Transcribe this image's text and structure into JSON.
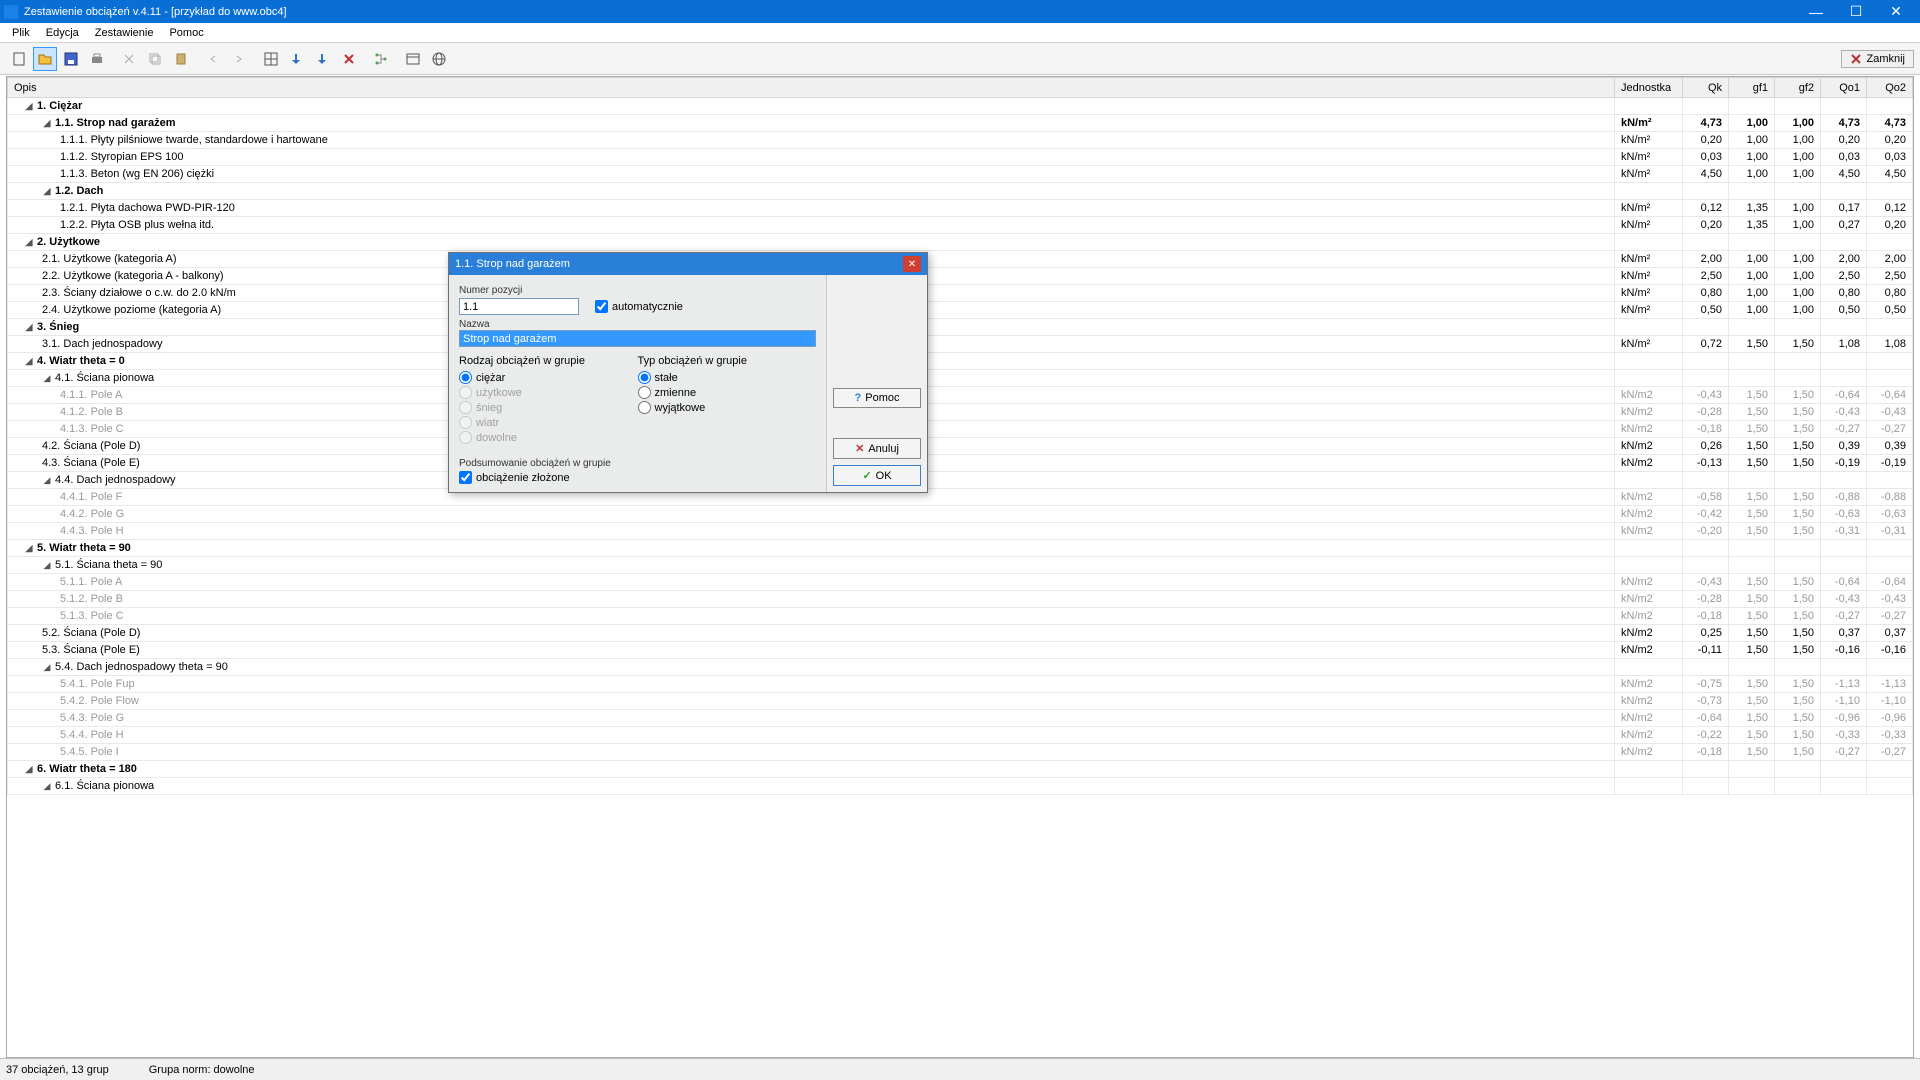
{
  "titlebar": {
    "title": "Zestawienie obciążeń v.4.11 - [przykład do www.obc4]"
  },
  "menu": {
    "plik": "Plik",
    "edycja": "Edycja",
    "zest": "Zestawienie",
    "pomoc": "Pomoc"
  },
  "toolbar": {
    "close": "Zamknij"
  },
  "headers": {
    "opis": "Opis",
    "jedn": "Jednostka",
    "qk": "Qk",
    "gf1": "gf1",
    "gf2": "gf2",
    "qo1": "Qo1",
    "qo2": "Qo2"
  },
  "rows": [
    {
      "lvl": 0,
      "arrow": 1,
      "bold": 1,
      "dim": 0,
      "opis": "1.  Ciężar",
      "j": "",
      "qk": "",
      "g1": "",
      "g2": "",
      "q1": "",
      "q2": ""
    },
    {
      "lvl": 1,
      "arrow": 1,
      "bold": 1,
      "dim": 0,
      "opis": "1.1.  Strop nad garażem",
      "j": "kN/m²",
      "qk": "4,73",
      "g1": "1,00",
      "g2": "1,00",
      "q1": "4,73",
      "q2": "4,73"
    },
    {
      "lvl": 2,
      "arrow": 0,
      "bold": 0,
      "dim": 0,
      "opis": "1.1.1.  Płyty pilśniowe twarde, standardowe i hartowane",
      "j": "kN/m²",
      "qk": "0,20",
      "g1": "1,00",
      "g2": "1,00",
      "q1": "0,20",
      "q2": "0,20"
    },
    {
      "lvl": 2,
      "arrow": 0,
      "bold": 0,
      "dim": 0,
      "opis": "1.1.2.  Styropian EPS 100",
      "j": "kN/m²",
      "qk": "0,03",
      "g1": "1,00",
      "g2": "1,00",
      "q1": "0,03",
      "q2": "0,03"
    },
    {
      "lvl": 2,
      "arrow": 0,
      "bold": 0,
      "dim": 0,
      "opis": "1.1.3.  Beton (wg EN 206) ciężki",
      "j": "kN/m²",
      "qk": "4,50",
      "g1": "1,00",
      "g2": "1,00",
      "q1": "4,50",
      "q2": "4,50"
    },
    {
      "lvl": 1,
      "arrow": 1,
      "bold": 1,
      "dim": 0,
      "opis": "1.2.  Dach",
      "j": "",
      "qk": "",
      "g1": "",
      "g2": "",
      "q1": "",
      "q2": ""
    },
    {
      "lvl": 2,
      "arrow": 0,
      "bold": 0,
      "dim": 0,
      "opis": "1.2.1.  Płyta dachowa PWD-PIR-120",
      "j": "kN/m²",
      "qk": "0,12",
      "g1": "1,35",
      "g2": "1,00",
      "q1": "0,17",
      "q2": "0,12"
    },
    {
      "lvl": 2,
      "arrow": 0,
      "bold": 0,
      "dim": 0,
      "opis": "1.2.2.  Płyta OSB plus wełna itd.",
      "j": "kN/m²",
      "qk": "0,20",
      "g1": "1,35",
      "g2": "1,00",
      "q1": "0,27",
      "q2": "0,20"
    },
    {
      "lvl": 0,
      "arrow": 1,
      "bold": 1,
      "dim": 0,
      "opis": "2.  Użytkowe",
      "j": "",
      "qk": "",
      "g1": "",
      "g2": "",
      "q1": "",
      "q2": ""
    },
    {
      "lvl": 1,
      "arrow": 0,
      "bold": 0,
      "dim": 0,
      "opis": "2.1.  Użytkowe (kategoria A)",
      "j": "kN/m²",
      "qk": "2,00",
      "g1": "1,00",
      "g2": "1,00",
      "q1": "2,00",
      "q2": "2,00"
    },
    {
      "lvl": 1,
      "arrow": 0,
      "bold": 0,
      "dim": 0,
      "opis": "2.2.  Użytkowe (kategoria A - balkony)",
      "j": "kN/m²",
      "qk": "2,50",
      "g1": "1,00",
      "g2": "1,00",
      "q1": "2,50",
      "q2": "2,50"
    },
    {
      "lvl": 1,
      "arrow": 0,
      "bold": 0,
      "dim": 0,
      "opis": "2.3.  Ściany działowe o c.w. do 2.0 kN/m",
      "j": "kN/m²",
      "qk": "0,80",
      "g1": "1,00",
      "g2": "1,00",
      "q1": "0,80",
      "q2": "0,80"
    },
    {
      "lvl": 1,
      "arrow": 0,
      "bold": 0,
      "dim": 0,
      "opis": "2.4.  Użytkowe poziome (kategoria A)",
      "j": "kN/m²",
      "qk": "0,50",
      "g1": "1,00",
      "g2": "1,00",
      "q1": "0,50",
      "q2": "0,50"
    },
    {
      "lvl": 0,
      "arrow": 1,
      "bold": 1,
      "dim": 0,
      "opis": "3.  Śnieg",
      "j": "",
      "qk": "",
      "g1": "",
      "g2": "",
      "q1": "",
      "q2": ""
    },
    {
      "lvl": 1,
      "arrow": 0,
      "bold": 0,
      "dim": 0,
      "opis": "3.1.  Dach jednospadowy",
      "j": "kN/m²",
      "qk": "0,72",
      "g1": "1,50",
      "g2": "1,50",
      "q1": "1,08",
      "q2": "1,08"
    },
    {
      "lvl": 0,
      "arrow": 1,
      "bold": 1,
      "dim": 0,
      "opis": "4.  Wiatr theta = 0",
      "j": "",
      "qk": "",
      "g1": "",
      "g2": "",
      "q1": "",
      "q2": ""
    },
    {
      "lvl": 1,
      "arrow": 1,
      "bold": 0,
      "dim": 0,
      "opis": "4.1.  Ściana pionowa",
      "j": "",
      "qk": "",
      "g1": "",
      "g2": "",
      "q1": "",
      "q2": ""
    },
    {
      "lvl": 2,
      "arrow": 0,
      "bold": 0,
      "dim": 1,
      "opis": "4.1.1.  Pole A",
      "j": "kN/m2",
      "qk": "-0,43",
      "g1": "1,50",
      "g2": "1,50",
      "q1": "-0,64",
      "q2": "-0,64"
    },
    {
      "lvl": 2,
      "arrow": 0,
      "bold": 0,
      "dim": 1,
      "opis": "4.1.2.  Pole B",
      "j": "kN/m2",
      "qk": "-0,28",
      "g1": "1,50",
      "g2": "1,50",
      "q1": "-0,43",
      "q2": "-0,43"
    },
    {
      "lvl": 2,
      "arrow": 0,
      "bold": 0,
      "dim": 1,
      "opis": "4.1.3.  Pole C",
      "j": "kN/m2",
      "qk": "-0,18",
      "g1": "1,50",
      "g2": "1,50",
      "q1": "-0,27",
      "q2": "-0,27"
    },
    {
      "lvl": 1,
      "arrow": 0,
      "bold": 0,
      "dim": 0,
      "opis": "4.2.  Ściana (Pole D)",
      "j": "kN/m2",
      "qk": "0,26",
      "g1": "1,50",
      "g2": "1,50",
      "q1": "0,39",
      "q2": "0,39"
    },
    {
      "lvl": 1,
      "arrow": 0,
      "bold": 0,
      "dim": 0,
      "opis": "4.3.  Ściana (Pole E)",
      "j": "kN/m2",
      "qk": "-0,13",
      "g1": "1,50",
      "g2": "1,50",
      "q1": "-0,19",
      "q2": "-0,19"
    },
    {
      "lvl": 1,
      "arrow": 1,
      "bold": 0,
      "dim": 0,
      "opis": "4.4.  Dach jednospadowy",
      "j": "",
      "qk": "",
      "g1": "",
      "g2": "",
      "q1": "",
      "q2": ""
    },
    {
      "lvl": 2,
      "arrow": 0,
      "bold": 0,
      "dim": 1,
      "opis": "4.4.1.  Pole F",
      "j": "kN/m2",
      "qk": "-0,58",
      "g1": "1,50",
      "g2": "1,50",
      "q1": "-0,88",
      "q2": "-0,88"
    },
    {
      "lvl": 2,
      "arrow": 0,
      "bold": 0,
      "dim": 1,
      "opis": "4.4.2.  Pole G",
      "j": "kN/m2",
      "qk": "-0,42",
      "g1": "1,50",
      "g2": "1,50",
      "q1": "-0,63",
      "q2": "-0,63"
    },
    {
      "lvl": 2,
      "arrow": 0,
      "bold": 0,
      "dim": 1,
      "opis": "4.4.3.  Pole H",
      "j": "kN/m2",
      "qk": "-0,20",
      "g1": "1,50",
      "g2": "1,50",
      "q1": "-0,31",
      "q2": "-0,31"
    },
    {
      "lvl": 0,
      "arrow": 1,
      "bold": 1,
      "dim": 0,
      "opis": "5.  Wiatr theta = 90",
      "j": "",
      "qk": "",
      "g1": "",
      "g2": "",
      "q1": "",
      "q2": ""
    },
    {
      "lvl": 1,
      "arrow": 1,
      "bold": 0,
      "dim": 0,
      "opis": "5.1.  Ściana theta = 90",
      "j": "",
      "qk": "",
      "g1": "",
      "g2": "",
      "q1": "",
      "q2": ""
    },
    {
      "lvl": 2,
      "arrow": 0,
      "bold": 0,
      "dim": 1,
      "opis": "5.1.1.  Pole A",
      "j": "kN/m2",
      "qk": "-0,43",
      "g1": "1,50",
      "g2": "1,50",
      "q1": "-0,64",
      "q2": "-0,64"
    },
    {
      "lvl": 2,
      "arrow": 0,
      "bold": 0,
      "dim": 1,
      "opis": "5.1.2.  Pole B",
      "j": "kN/m2",
      "qk": "-0,28",
      "g1": "1,50",
      "g2": "1,50",
      "q1": "-0,43",
      "q2": "-0,43"
    },
    {
      "lvl": 2,
      "arrow": 0,
      "bold": 0,
      "dim": 1,
      "opis": "5.1.3.  Pole C",
      "j": "kN/m2",
      "qk": "-0,18",
      "g1": "1,50",
      "g2": "1,50",
      "q1": "-0,27",
      "q2": "-0,27"
    },
    {
      "lvl": 1,
      "arrow": 0,
      "bold": 0,
      "dim": 0,
      "opis": "5.2.  Ściana (Pole D)",
      "j": "kN/m2",
      "qk": "0,25",
      "g1": "1,50",
      "g2": "1,50",
      "q1": "0,37",
      "q2": "0,37"
    },
    {
      "lvl": 1,
      "arrow": 0,
      "bold": 0,
      "dim": 0,
      "opis": "5.3.  Ściana (Pole E)",
      "j": "kN/m2",
      "qk": "-0,11",
      "g1": "1,50",
      "g2": "1,50",
      "q1": "-0,16",
      "q2": "-0,16"
    },
    {
      "lvl": 1,
      "arrow": 1,
      "bold": 0,
      "dim": 0,
      "opis": "5.4.  Dach jednospadowy theta = 90",
      "j": "",
      "qk": "",
      "g1": "",
      "g2": "",
      "q1": "",
      "q2": ""
    },
    {
      "lvl": 2,
      "arrow": 0,
      "bold": 0,
      "dim": 1,
      "opis": "5.4.1.  Pole Fup",
      "j": "kN/m2",
      "qk": "-0,75",
      "g1": "1,50",
      "g2": "1,50",
      "q1": "-1,13",
      "q2": "-1,13"
    },
    {
      "lvl": 2,
      "arrow": 0,
      "bold": 0,
      "dim": 1,
      "opis": "5.4.2.  Pole Flow",
      "j": "kN/m2",
      "qk": "-0,73",
      "g1": "1,50",
      "g2": "1,50",
      "q1": "-1,10",
      "q2": "-1,10"
    },
    {
      "lvl": 2,
      "arrow": 0,
      "bold": 0,
      "dim": 1,
      "opis": "5.4.3.  Pole G",
      "j": "kN/m2",
      "qk": "-0,64",
      "g1": "1,50",
      "g2": "1,50",
      "q1": "-0,96",
      "q2": "-0,96"
    },
    {
      "lvl": 2,
      "arrow": 0,
      "bold": 0,
      "dim": 1,
      "opis": "5.4.4.  Pole H",
      "j": "kN/m2",
      "qk": "-0,22",
      "g1": "1,50",
      "g2": "1,50",
      "q1": "-0,33",
      "q2": "-0,33"
    },
    {
      "lvl": 2,
      "arrow": 0,
      "bold": 0,
      "dim": 1,
      "opis": "5.4.5.  Pole I",
      "j": "kN/m2",
      "qk": "-0,18",
      "g1": "1,50",
      "g2": "1,50",
      "q1": "-0,27",
      "q2": "-0,27"
    },
    {
      "lvl": 0,
      "arrow": 1,
      "bold": 1,
      "dim": 0,
      "opis": "6.  Wiatr theta = 180",
      "j": "",
      "qk": "",
      "g1": "",
      "g2": "",
      "q1": "",
      "q2": ""
    },
    {
      "lvl": 1,
      "arrow": 1,
      "bold": 0,
      "dim": 0,
      "opis": "6.1.  Ściana pionowa",
      "j": "",
      "qk": "",
      "g1": "",
      "g2": "",
      "q1": "",
      "q2": ""
    }
  ],
  "status": {
    "left": "37 obciążeń, 13 grup",
    "mid": "Grupa norm: dowolne"
  },
  "dialog": {
    "title": "1.1.  Strop nad garażem",
    "lbl_numer": "Numer pozycji",
    "numer": "1.1",
    "auto": "automatycznie",
    "lbl_nazwa": "Nazwa",
    "nazwa": "Strop nad garażem",
    "h_rodzaj": "Rodzaj obciążeń w grupie",
    "h_typ": "Typ obciążeń w grupie",
    "r_ciezar": "ciężar",
    "r_uzytkowe": "użytkowe",
    "r_snieg": "śnieg",
    "r_wiatr": "wiatr",
    "r_dowolne": "dowolne",
    "t_stale": "stałe",
    "t_zmienne": "zmienne",
    "t_wyj": "wyjątkowe",
    "h_pods": "Podsumowanie obciążeń w grupie",
    "c_zlozone": "obciążenie złożone",
    "b_pomoc": "Pomoc",
    "b_anuluj": "Anuluj",
    "b_ok": "OK"
  }
}
